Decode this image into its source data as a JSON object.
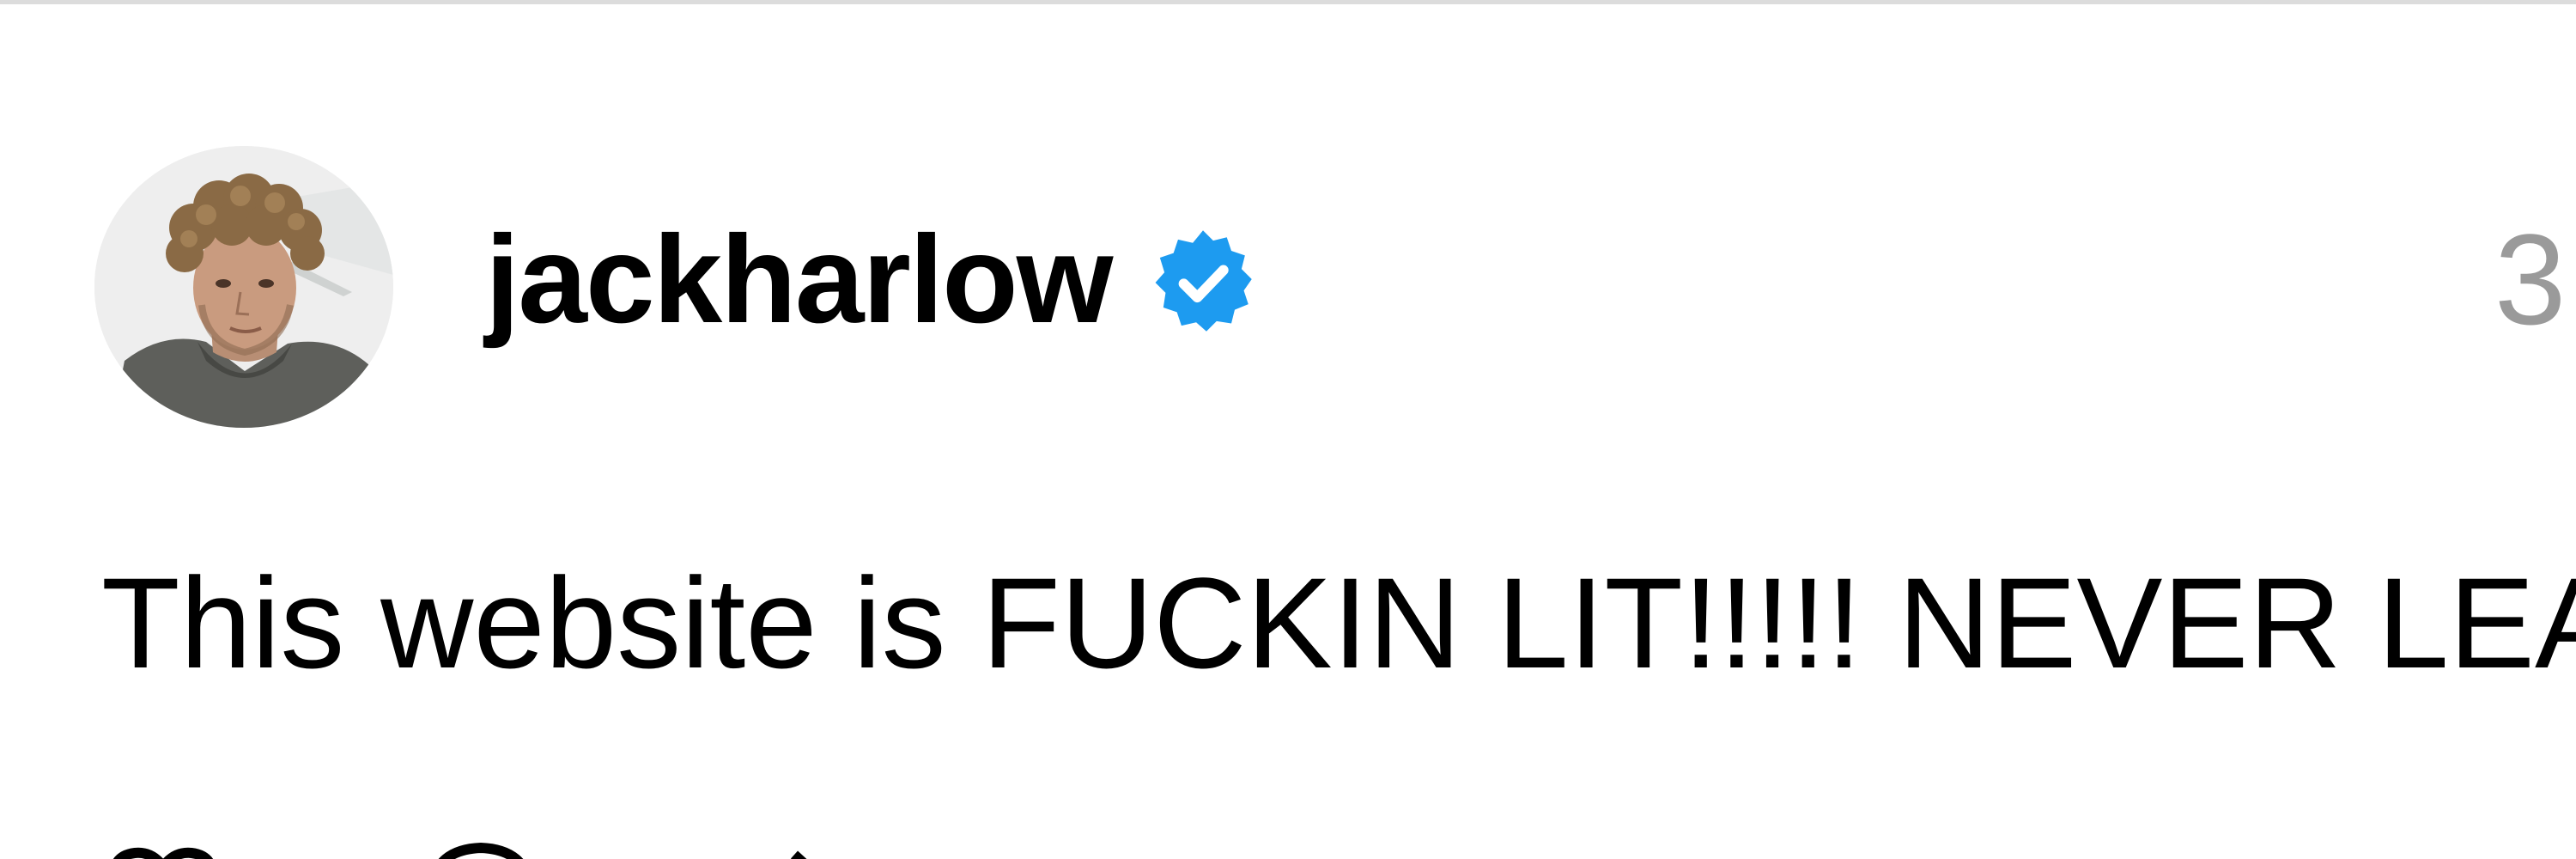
{
  "post": {
    "author": {
      "username": "jackharlow",
      "verified": true,
      "avatar_icon": "profile-photo"
    },
    "timestamp": "3",
    "text": "This website is FUCKIN LIT!!!!! NEVER LEA"
  },
  "actions": [
    {
      "icon": "heart-icon"
    },
    {
      "icon": "comment-icon"
    },
    {
      "icon": "repost-icon"
    },
    {
      "icon": "share-icon"
    }
  ],
  "colors": {
    "verified": "#1d9bf0",
    "timestamp": "#9a9a9a",
    "divider": "#dcdcdc"
  }
}
